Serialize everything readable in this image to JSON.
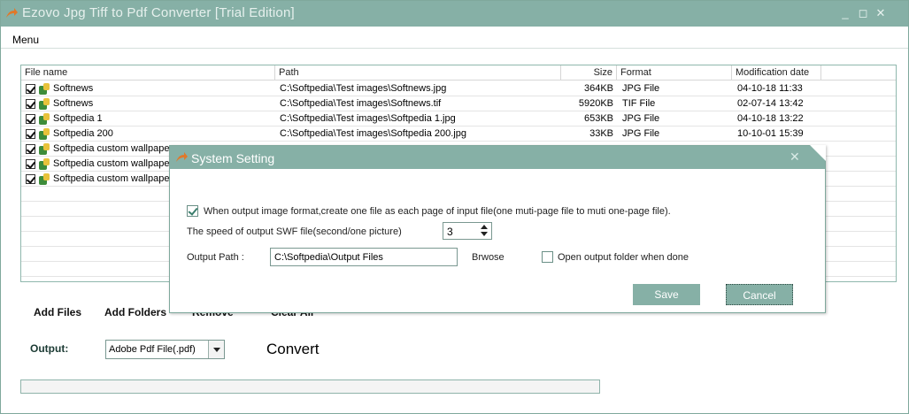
{
  "window": {
    "title": "Ezovo Jpg Tiff to Pdf Converter [Trial Edition]",
    "controls": {
      "minimize": "_",
      "maximize": "◻",
      "close": "✕"
    }
  },
  "menu": {
    "label": "Menu"
  },
  "file_list": {
    "columns": [
      "File name",
      "Path",
      "Size",
      "Format",
      "Modification date"
    ],
    "rows": [
      {
        "name": "Softnews",
        "path": "C:\\Softpedia\\Test images\\Softnews.jpg",
        "size": "364KB",
        "format": "JPG File",
        "date": "04-10-18 11:33"
      },
      {
        "name": "Softnews",
        "path": "C:\\Softpedia\\Test images\\Softnews.tif",
        "size": "5920KB",
        "format": "TIF File",
        "date": "02-07-14 13:42"
      },
      {
        "name": "Softpedia 1",
        "path": "C:\\Softpedia\\Test images\\Softpedia 1.jpg",
        "size": "653KB",
        "format": "JPG File",
        "date": "04-10-18 13:22"
      },
      {
        "name": "Softpedia 200",
        "path": "C:\\Softpedia\\Test images\\Softpedia 200.jpg",
        "size": "33KB",
        "format": "JPG File",
        "date": "10-10-01 15:39"
      },
      {
        "name": "Softpedia custom wallpaper",
        "path": "",
        "size": "",
        "format": "",
        "date": ""
      },
      {
        "name": "Softpedia custom wallpaper",
        "path": "",
        "size": "",
        "format": "",
        "date": ""
      },
      {
        "name": "Softpedia custom wallpaper",
        "path": "",
        "size": "",
        "format": "",
        "date": ""
      }
    ]
  },
  "actions": {
    "add_files": "Add Files",
    "add_folders": "Add Folders",
    "remove": "Remove",
    "clear_all": "Clear All"
  },
  "output": {
    "label": "Output:",
    "selected": "Adobe Pdf File(.pdf)",
    "convert": "Convert",
    "progress": 1.0
  },
  "dialog": {
    "title": "System Setting",
    "close": "✕",
    "one_file_per_page": {
      "label": "When output image format,create one file as each page of input file(one muti-page file to muti one-page file).",
      "checked": true
    },
    "swf_speed": {
      "label": "The speed of output SWF file(second/one picture)",
      "value": "3"
    },
    "output_path": {
      "label": "Output Path :",
      "value": "C:\\Softpedia\\Output Files"
    },
    "browse": "Brwose",
    "open_when_done": {
      "label": "Open output folder when done",
      "checked": false
    },
    "save": "Save",
    "cancel": "Cancel"
  },
  "colors": {
    "accent": "#86b0a6",
    "border": "#7fa89c"
  }
}
